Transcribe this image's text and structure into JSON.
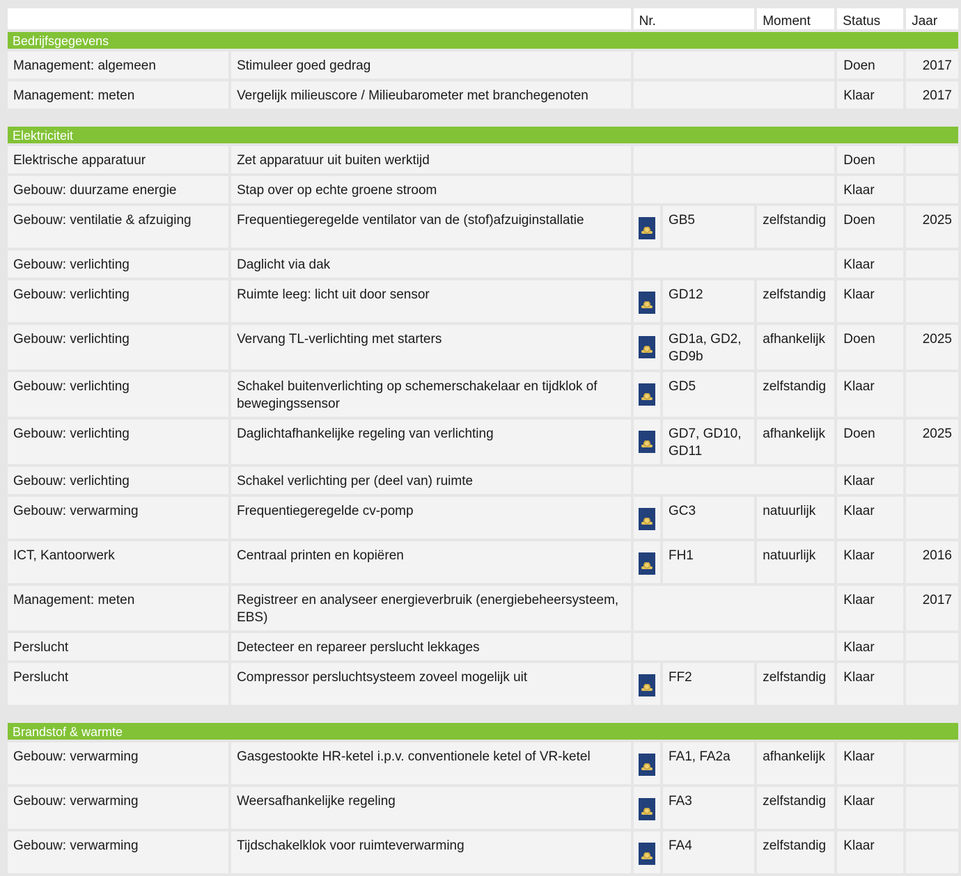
{
  "header": {
    "nr": "Nr.",
    "moment": "Moment",
    "status": "Status",
    "jaar": "Jaar"
  },
  "sections": [
    {
      "title": "Bedrijfsgegevens",
      "rows": [
        {
          "category": "Management: algemeen",
          "measure": "Stimuleer goed gedrag",
          "logo": false,
          "nr": "",
          "moment": "",
          "status": "Doen",
          "jaar": "2017"
        },
        {
          "category": "Management: meten",
          "measure": "Vergelijk milieuscore / Milieubarometer met branchegenoten",
          "logo": false,
          "nr": "",
          "moment": "",
          "status": "Klaar",
          "jaar": "2017"
        }
      ]
    },
    {
      "title": "Elektriciteit",
      "rows": [
        {
          "category": "Elektrische apparatuur",
          "measure": "Zet apparatuur uit buiten werktijd",
          "logo": false,
          "nr": "",
          "moment": "",
          "status": "Doen",
          "jaar": ""
        },
        {
          "category": "Gebouw: duurzame energie",
          "measure": "Stap over op echte groene stroom",
          "logo": false,
          "nr": "",
          "moment": "",
          "status": "Klaar",
          "jaar": ""
        },
        {
          "category": "Gebouw: ventilatie & afzuiging",
          "measure": "Frequentiegeregelde ventilator van de (stof)afzuiginstallatie",
          "logo": true,
          "nr": "GB5",
          "moment": "zelfstandig",
          "status": "Doen",
          "jaar": "2025"
        },
        {
          "category": "Gebouw: verlichting",
          "measure": "Daglicht via dak",
          "logo": false,
          "nr": "",
          "moment": "",
          "status": "Klaar",
          "jaar": ""
        },
        {
          "category": "Gebouw: verlichting",
          "measure": "Ruimte leeg: licht uit door sensor",
          "logo": true,
          "nr": "GD12",
          "moment": "zelfstandig",
          "status": "Klaar",
          "jaar": ""
        },
        {
          "category": "Gebouw: verlichting",
          "measure": "Vervang TL-verlichting met starters",
          "logo": true,
          "nr": "GD1a, GD2, GD9b",
          "moment": "afhankelijk",
          "status": "Doen",
          "jaar": "2025"
        },
        {
          "category": "Gebouw: verlichting",
          "measure": "Schakel buitenverlichting op schemerschakelaar en tijdklok of bewegingssensor",
          "logo": true,
          "nr": "GD5",
          "moment": "zelfstandig",
          "status": "Klaar",
          "jaar": ""
        },
        {
          "category": "Gebouw: verlichting",
          "measure": "Daglichtafhankelijke regeling van verlichting",
          "logo": true,
          "nr": "GD7, GD10, GD11",
          "moment": "afhankelijk",
          "status": "Doen",
          "jaar": "2025"
        },
        {
          "category": "Gebouw: verlichting",
          "measure": "Schakel verlichting per (deel van) ruimte",
          "logo": false,
          "nr": "",
          "moment": "",
          "status": "Klaar",
          "jaar": ""
        },
        {
          "category": "Gebouw: verwarming",
          "measure": "Frequentiegeregelde cv-pomp",
          "logo": true,
          "nr": "GC3",
          "moment": "natuurlijk",
          "status": "Klaar",
          "jaar": ""
        },
        {
          "category": "ICT, Kantoorwerk",
          "measure": "Centraal printen en kopiëren",
          "logo": true,
          "nr": "FH1",
          "moment": "natuurlijk",
          "status": "Klaar",
          "jaar": "2016"
        },
        {
          "category": "Management: meten",
          "measure": "Registreer en analyseer energieverbruik (energiebeheersysteem, EBS)",
          "logo": false,
          "nr": "",
          "moment": "",
          "status": "Klaar",
          "jaar": "2017"
        },
        {
          "category": "Perslucht",
          "measure": "Detecteer en repareer perslucht lekkages",
          "logo": false,
          "nr": "",
          "moment": "",
          "status": "Klaar",
          "jaar": ""
        },
        {
          "category": "Perslucht",
          "measure": "Compressor persluchtsysteem zoveel mogelijk uit",
          "logo": true,
          "nr": "FF2",
          "moment": "zelfstandig",
          "status": "Klaar",
          "jaar": ""
        }
      ]
    },
    {
      "title": "Brandstof & warmte",
      "rows": [
        {
          "category": "Gebouw: verwarming",
          "measure": "Gasgestookte HR-ketel i.p.v. conventionele ketel of VR-ketel",
          "logo": true,
          "nr": "FA1, FA2a",
          "moment": "afhankelijk",
          "status": "Klaar",
          "jaar": ""
        },
        {
          "category": "Gebouw: verwarming",
          "measure": "Weersafhankelijke regeling",
          "logo": true,
          "nr": "FA3",
          "moment": "zelfstandig",
          "status": "Klaar",
          "jaar": ""
        },
        {
          "category": "Gebouw: verwarming",
          "measure": "Tijdschakelklok voor ruimteverwarming",
          "logo": true,
          "nr": "FA4",
          "moment": "zelfstandig",
          "status": "Klaar",
          "jaar": ""
        }
      ]
    }
  ]
}
